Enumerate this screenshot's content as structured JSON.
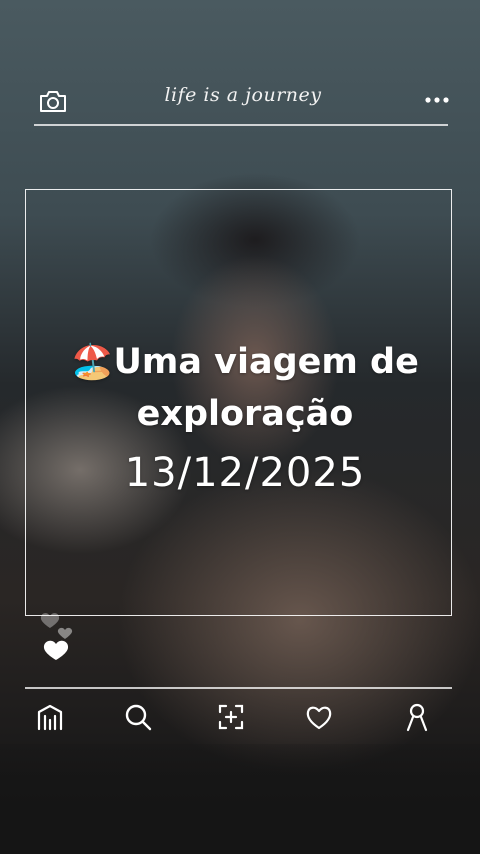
{
  "header": {
    "brand": "life is a journey",
    "camera_icon": "camera-icon",
    "more_icon": "more-icon"
  },
  "post": {
    "emoji": "🏖️",
    "caption_line1": "Uma viagem de",
    "caption_line2": "exploração",
    "date": "13/12/2025"
  },
  "reactions": {
    "icon": "heart-icon"
  },
  "tabbar": {
    "items": [
      {
        "name": "home-icon"
      },
      {
        "name": "search-icon"
      },
      {
        "name": "add-post-icon"
      },
      {
        "name": "heart-icon"
      },
      {
        "name": "profile-icon"
      }
    ]
  },
  "colors": {
    "text": "#ffffff",
    "background": "#2a3438"
  }
}
